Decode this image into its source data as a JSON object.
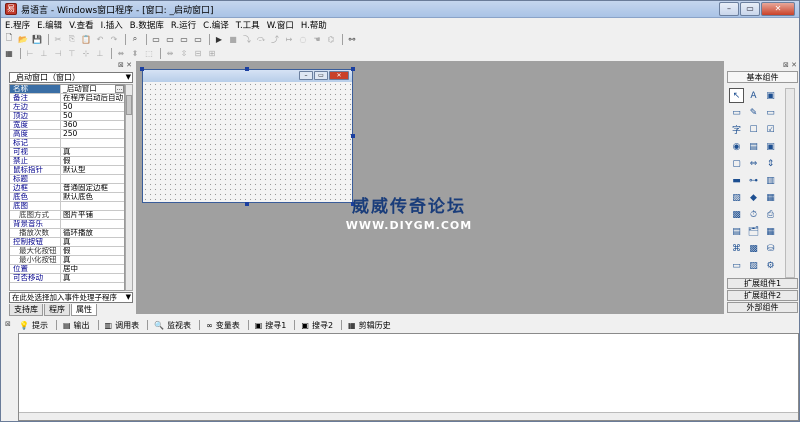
{
  "window": {
    "title": "易语言 - Windows窗口程序 - [窗口: _启动窗口]",
    "app_icon": "易",
    "min": "–",
    "max": "▭",
    "close": "✕"
  },
  "menus": [
    "E.程序",
    "E.编辑",
    "V.查看",
    "I.插入",
    "B.数据库",
    "R.运行",
    "C.编译",
    "T.工具",
    "W.窗口",
    "H.帮助"
  ],
  "left_panel": {
    "object_selector": "_启动窗口（窗口）",
    "properties": [
      {
        "name": "名称",
        "value": "_启动窗口",
        "selected": true,
        "button": "…"
      },
      {
        "name": "备注",
        "value": "在程序启动后自动"
      },
      {
        "name": "左边",
        "value": "50"
      },
      {
        "name": "顶边",
        "value": "50"
      },
      {
        "name": "宽度",
        "value": "360"
      },
      {
        "name": "高度",
        "value": "250"
      },
      {
        "name": "标记",
        "value": ""
      },
      {
        "name": "可视",
        "value": "真"
      },
      {
        "name": "禁止",
        "value": "假"
      },
      {
        "name": "鼠标指针",
        "value": "默认型"
      },
      {
        "name": "标题",
        "value": ""
      },
      {
        "name": "边框",
        "value": "普通固定边框"
      },
      {
        "name": "底色",
        "value": "默认底色"
      },
      {
        "name": "底图",
        "value": ""
      },
      {
        "name": "底图方式",
        "value": "图片平铺",
        "sub": true
      },
      {
        "name": "背景音乐",
        "value": ""
      },
      {
        "name": "播放次数",
        "value": "循环播放",
        "sub": true
      },
      {
        "name": "控制按钮",
        "value": "真"
      },
      {
        "name": "最大化按钮",
        "value": "假",
        "sub": true
      },
      {
        "name": "最小化按钮",
        "value": "真",
        "sub": true
      },
      {
        "name": "位置",
        "value": "居中"
      },
      {
        "name": "可否移动",
        "value": "真"
      }
    ],
    "event_selector": "在此处选择加入事件处理子程序",
    "tabs": [
      "支持库",
      "程序",
      "属性"
    ]
  },
  "watermark": {
    "line1": "威威传奇论坛",
    "line2": "WWW.DIYGM.COM"
  },
  "right_panel": {
    "header": "基本组件",
    "components": [
      "pointer-icon",
      "label-icon",
      "picture-icon",
      "frame-icon",
      "edit-icon",
      "button-icon",
      "text-icon",
      "checkbox-icon",
      "radio-icon",
      "combobox-icon",
      "listbox-icon",
      "group-icon",
      "hscroll-icon",
      "vscroll-icon",
      "progress-icon",
      "slider-icon",
      "tab-icon",
      "image-icon",
      "shape-icon",
      "drawbox-icon",
      "panel-icon",
      "timer-icon",
      "printer-icon",
      "listview-icon",
      "treeview-icon",
      "calendar-icon",
      "datagrid-icon",
      "socket-icon",
      "db-icon",
      "client-icon",
      "server-icon",
      "port-icon",
      "table-icon",
      "ole-icon",
      "media-icon",
      "chart-icon"
    ],
    "buttons": [
      "扩展组件1",
      "扩展组件2",
      "外部组件"
    ]
  },
  "bottom_tabs": [
    {
      "icon": "pin-icon",
      "glyph": "💡",
      "label": "提示"
    },
    {
      "icon": "output-icon",
      "glyph": "▤",
      "label": "输出"
    },
    {
      "icon": "call-table-icon",
      "glyph": "▥",
      "label": "调用表"
    },
    {
      "icon": "watch-icon",
      "glyph": "🔍",
      "label": "监视表"
    },
    {
      "icon": "variable-icon",
      "glyph": "∞",
      "label": "变量表"
    },
    {
      "icon": "search1-icon",
      "glyph": "▣",
      "label": "搜寻1"
    },
    {
      "icon": "search2-icon",
      "glyph": "▣",
      "label": "搜寻2"
    },
    {
      "icon": "clipboard-icon",
      "glyph": "▦",
      "label": "剪辑历史"
    }
  ]
}
